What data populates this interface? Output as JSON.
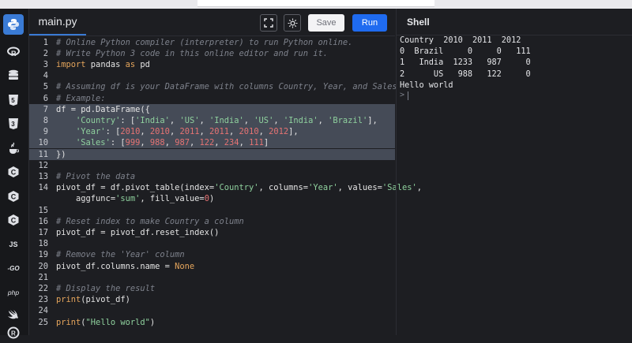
{
  "editor": {
    "file_tab": "main.py",
    "save_label": "Save",
    "run_label": "Run",
    "lines": [
      {
        "n": "1",
        "segs": [
          {
            "t": "# Online Python compiler (interpreter) to run Python online.",
            "c": "cm"
          }
        ]
      },
      {
        "n": "2",
        "segs": [
          {
            "t": "# Write Python 3 code in this online editor and run it.",
            "c": "cm"
          }
        ]
      },
      {
        "n": "3",
        "segs": [
          {
            "t": "import",
            "c": "kw"
          },
          {
            "t": " pandas ",
            "c": ""
          },
          {
            "t": "as",
            "c": "kw"
          },
          {
            "t": " pd",
            "c": ""
          }
        ]
      },
      {
        "n": "4",
        "segs": []
      },
      {
        "n": "5",
        "segs": [
          {
            "t": "# Assuming df is your DataFrame with columns Country, Year, and Sales",
            "c": "cm"
          }
        ]
      },
      {
        "n": "6",
        "segs": [
          {
            "t": "# Example:",
            "c": "cm"
          }
        ]
      },
      {
        "n": "7",
        "hl": true,
        "segs": [
          {
            "t": "df = pd.DataFrame({",
            "c": ""
          }
        ]
      },
      {
        "n": "8",
        "hl": true,
        "segs": [
          {
            "t": "    ",
            "c": ""
          },
          {
            "t": "'Country'",
            "c": "st"
          },
          {
            "t": ": [",
            "c": ""
          },
          {
            "t": "'India'",
            "c": "st"
          },
          {
            "t": ", ",
            "c": ""
          },
          {
            "t": "'US'",
            "c": "st"
          },
          {
            "t": ", ",
            "c": ""
          },
          {
            "t": "'India'",
            "c": "st"
          },
          {
            "t": ", ",
            "c": ""
          },
          {
            "t": "'US'",
            "c": "st"
          },
          {
            "t": ", ",
            "c": ""
          },
          {
            "t": "'India'",
            "c": "st"
          },
          {
            "t": ", ",
            "c": ""
          },
          {
            "t": "'Brazil'",
            "c": "st"
          },
          {
            "t": "],",
            "c": ""
          }
        ]
      },
      {
        "n": "9",
        "hl": true,
        "segs": [
          {
            "t": "    ",
            "c": ""
          },
          {
            "t": "'Year'",
            "c": "st"
          },
          {
            "t": ": [",
            "c": ""
          },
          {
            "t": "2010",
            "c": "nm"
          },
          {
            "t": ", ",
            "c": ""
          },
          {
            "t": "2010",
            "c": "nm"
          },
          {
            "t": ", ",
            "c": ""
          },
          {
            "t": "2011",
            "c": "nm"
          },
          {
            "t": ", ",
            "c": ""
          },
          {
            "t": "2011",
            "c": "nm"
          },
          {
            "t": ", ",
            "c": ""
          },
          {
            "t": "2010",
            "c": "nm"
          },
          {
            "t": ", ",
            "c": ""
          },
          {
            "t": "2012",
            "c": "nm"
          },
          {
            "t": "],",
            "c": ""
          }
        ]
      },
      {
        "n": "10",
        "hl": true,
        "segs": [
          {
            "t": "    ",
            "c": ""
          },
          {
            "t": "'Sales'",
            "c": "st"
          },
          {
            "t": ": [",
            "c": ""
          },
          {
            "t": "999",
            "c": "nm"
          },
          {
            "t": ", ",
            "c": ""
          },
          {
            "t": "988",
            "c": "nm"
          },
          {
            "t": ", ",
            "c": ""
          },
          {
            "t": "987",
            "c": "nm"
          },
          {
            "t": ", ",
            "c": ""
          },
          {
            "t": "122",
            "c": "nm"
          },
          {
            "t": ", ",
            "c": ""
          },
          {
            "t": "234",
            "c": "nm"
          },
          {
            "t": ", ",
            "c": ""
          },
          {
            "t": "111",
            "c": "nm"
          },
          {
            "t": "]",
            "c": ""
          }
        ]
      },
      {
        "n": "11",
        "hl": true,
        "segs": [
          {
            "t": "})",
            "c": ""
          }
        ]
      },
      {
        "n": "12",
        "segs": []
      },
      {
        "n": "13",
        "segs": [
          {
            "t": "# Pivot the data",
            "c": "cm"
          }
        ]
      },
      {
        "n": "14",
        "segs": [
          {
            "t": "pivot_df = df.pivot_table(index=",
            "c": ""
          },
          {
            "t": "'Country'",
            "c": "st"
          },
          {
            "t": ", columns=",
            "c": ""
          },
          {
            "t": "'Year'",
            "c": "st"
          },
          {
            "t": ", values=",
            "c": ""
          },
          {
            "t": "'Sales'",
            "c": "st"
          },
          {
            "t": ",",
            "c": ""
          }
        ]
      },
      {
        "n": "",
        "segs": [
          {
            "t": "    aggfunc=",
            "c": ""
          },
          {
            "t": "'sum'",
            "c": "st"
          },
          {
            "t": ", fill_value=",
            "c": ""
          },
          {
            "t": "0",
            "c": "nm"
          },
          {
            "t": ")",
            "c": ""
          }
        ]
      },
      {
        "n": "15",
        "segs": []
      },
      {
        "n": "16",
        "segs": [
          {
            "t": "# Reset index to make Country a column",
            "c": "cm"
          }
        ]
      },
      {
        "n": "17",
        "segs": [
          {
            "t": "pivot_df = pivot_df.reset_index()",
            "c": ""
          }
        ]
      },
      {
        "n": "18",
        "segs": []
      },
      {
        "n": "19",
        "segs": [
          {
            "t": "# Remove the 'Year' column",
            "c": "cm"
          }
        ]
      },
      {
        "n": "20",
        "segs": [
          {
            "t": "pivot_df.columns.name = ",
            "c": ""
          },
          {
            "t": "None",
            "c": "kw"
          }
        ]
      },
      {
        "n": "21",
        "segs": []
      },
      {
        "n": "22",
        "segs": [
          {
            "t": "# Display the result",
            "c": "cm"
          }
        ]
      },
      {
        "n": "23",
        "segs": [
          {
            "t": "print",
            "c": "kw"
          },
          {
            "t": "(pivot_df)",
            "c": ""
          }
        ]
      },
      {
        "n": "24",
        "segs": []
      },
      {
        "n": "25",
        "segs": [
          {
            "t": "print",
            "c": "kw"
          },
          {
            "t": "(",
            "c": ""
          },
          {
            "t": "\"Hello world\"",
            "c": "st"
          },
          {
            "t": ")",
            "c": ""
          }
        ]
      }
    ]
  },
  "shell": {
    "title": "Shell",
    "output": [
      "Country  2010  2011  2012",
      "0  Brazil     0     0   111",
      "1   India  1233   987     0",
      "2      US   988   122     0",
      "Hello world"
    ],
    "prompt": ">"
  },
  "sidebar": {
    "items": [
      {
        "icon": "python-icon",
        "label": ""
      },
      {
        "icon": "r-icon",
        "label": ""
      },
      {
        "icon": "database-icon",
        "label": ""
      },
      {
        "icon": "html5-icon",
        "label": ""
      },
      {
        "icon": "css3-icon",
        "label": ""
      },
      {
        "icon": "java-icon",
        "label": ""
      },
      {
        "icon": "c-icon",
        "label": ""
      },
      {
        "icon": "cpp-icon",
        "label": ""
      },
      {
        "icon": "csharp-icon",
        "label": ""
      },
      {
        "icon": "javascript-icon",
        "label": "JS"
      },
      {
        "icon": "go-icon",
        "label": "-GO"
      },
      {
        "icon": "php-icon",
        "label": "php"
      },
      {
        "icon": "swift-icon",
        "label": ""
      },
      {
        "icon": "rust-icon",
        "label": ""
      }
    ]
  },
  "colors": {
    "accent": "#3a7bd5",
    "run_button": "#1f6bf0",
    "background": "#1d1e22"
  }
}
